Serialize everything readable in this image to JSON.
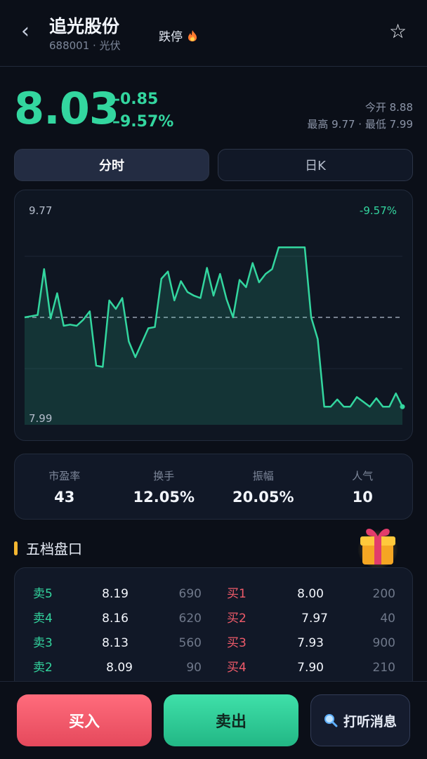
{
  "header": {
    "back_icon": "‹",
    "title": "追光股份",
    "code_line": "688001 · 光伏",
    "status_tag": "跌停",
    "fire_icon": "fire-icon",
    "star_icon": "☆"
  },
  "quote": {
    "price": "8.03",
    "change": "–0.85",
    "change_pct": "–9.57%",
    "open_text": "今开 8.88",
    "range_text": "最高 9.77 · 最低 7.99"
  },
  "tabs": [
    {
      "label": "分时",
      "active": true
    },
    {
      "label": "日K",
      "active": false
    }
  ],
  "chart_data": {
    "type": "line",
    "y_top_label": "9.77",
    "y_bottom_label": "7.99",
    "pct_label": "-9.57%",
    "ylim": [
      7.99,
      9.77
    ],
    "baseline": 8.88,
    "line_color": "#33d69f",
    "values": [
      8.88,
      8.89,
      8.9,
      9.28,
      8.87,
      9.08,
      8.81,
      8.82,
      8.81,
      8.86,
      8.93,
      8.48,
      8.47,
      9.02,
      8.95,
      9.04,
      8.68,
      8.55,
      8.67,
      8.79,
      8.8,
      9.2,
      9.26,
      9.02,
      9.18,
      9.09,
      9.06,
      9.04,
      9.29,
      9.06,
      9.24,
      9.03,
      8.88,
      9.19,
      9.13,
      9.33,
      9.17,
      9.24,
      9.28,
      9.46,
      9.46,
      9.46,
      9.46,
      9.46,
      8.88,
      8.7,
      8.14,
      8.14,
      8.2,
      8.14,
      8.14,
      8.22,
      8.18,
      8.14,
      8.21,
      8.14,
      8.14,
      8.25,
      8.14
    ]
  },
  "stats": [
    {
      "label": "市盈率",
      "value": "43"
    },
    {
      "label": "换手",
      "value": "12.05%"
    },
    {
      "label": "振幅",
      "value": "20.05%"
    },
    {
      "label": "人气",
      "value": "10"
    }
  ],
  "orderbook": {
    "title": "五档盘口",
    "rows": [
      {
        "sell_label": "卖5",
        "sell_price": "8.19",
        "sell_vol": "690",
        "buy_label": "买1",
        "buy_price": "8.00",
        "buy_vol": "200"
      },
      {
        "sell_label": "卖4",
        "sell_price": "8.16",
        "sell_vol": "620",
        "buy_label": "买2",
        "buy_price": "7.97",
        "buy_vol": "40"
      },
      {
        "sell_label": "卖3",
        "sell_price": "8.13",
        "sell_vol": "560",
        "buy_label": "买3",
        "buy_price": "7.93",
        "buy_vol": "900"
      },
      {
        "sell_label": "卖2",
        "sell_price": "8.09",
        "sell_vol": "90",
        "buy_label": "买4",
        "buy_price": "7.90",
        "buy_vol": "210"
      }
    ]
  },
  "actions": {
    "buy": "买入",
    "sell": "卖出",
    "news": "打听消息",
    "news_icon": "magnifier-icon"
  },
  "colors": {
    "up_green": "#33d69f",
    "down_red": "#f05b6a",
    "accent_gold": "#f5b731"
  }
}
